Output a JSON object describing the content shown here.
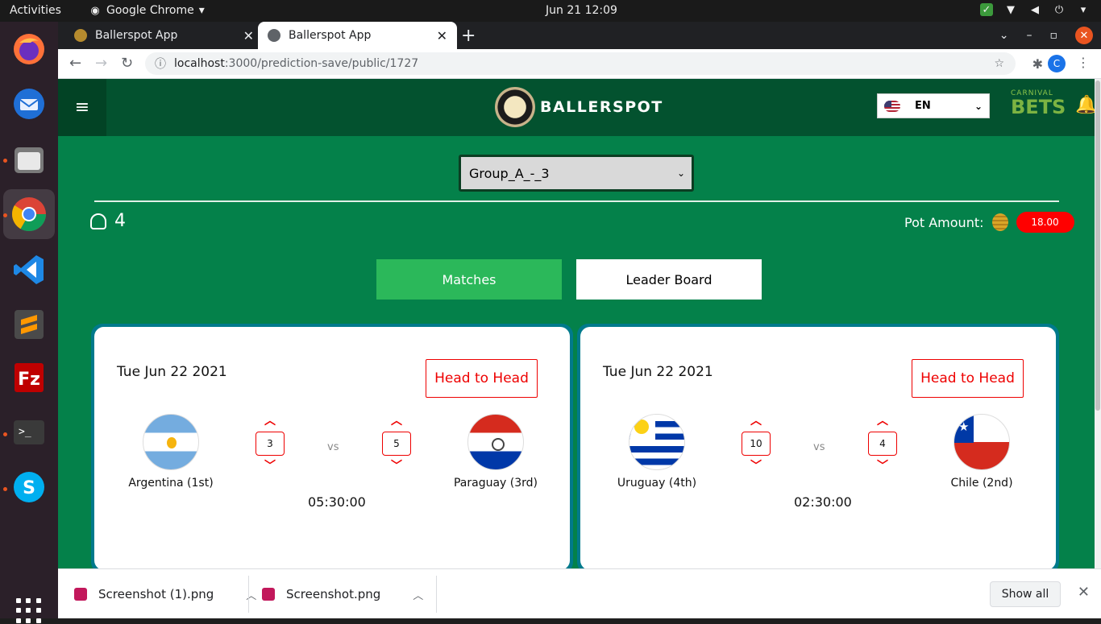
{
  "system": {
    "activities": "Activities",
    "app_menu": "Google Chrome",
    "clock": "Jun 21  12:09"
  },
  "browser": {
    "tabs": [
      {
        "title": "Ballerspot App",
        "active": false
      },
      {
        "title": "Ballerspot App",
        "active": true
      }
    ],
    "url_host": "localhost",
    "url_path": ":3000/prediction-save/public/1727",
    "profile_initial": "C"
  },
  "app": {
    "brand": "BALLERSPOT",
    "language": "EN",
    "sponsor_small": "CARNIVAL",
    "sponsor_big": "BETS",
    "group_select_value": "Group_A_-_3",
    "user_count": "4",
    "pot_label": "Pot Amount:",
    "pot_amount": "18.00",
    "tabs": {
      "matches": "Matches",
      "leaderboard": "Leader Board"
    },
    "matches": [
      {
        "date": "Tue Jun 22 2021",
        "h2h": "Head to Head",
        "home": {
          "name": "Argentina (1st)",
          "score": "3"
        },
        "away": {
          "name": "Paraguay (3rd)",
          "score": "5"
        },
        "vs": "vs",
        "time": "05:30:00"
      },
      {
        "date": "Tue Jun 22 2021",
        "h2h": "Head to Head",
        "home": {
          "name": "Uruguay (4th)",
          "score": "10"
        },
        "away": {
          "name": "Chile (2nd)",
          "score": "4"
        },
        "vs": "vs",
        "time": "02:30:00"
      }
    ]
  },
  "downloads": {
    "items": [
      "Screenshot (1).png",
      "Screenshot.png"
    ],
    "show_all": "Show all"
  },
  "colors": {
    "page_bg": "#04814a",
    "header_bg": "#03522f",
    "matches_btn": "#2bb85a",
    "accent_red": "#ff0000",
    "card_border": "#007a8c"
  }
}
